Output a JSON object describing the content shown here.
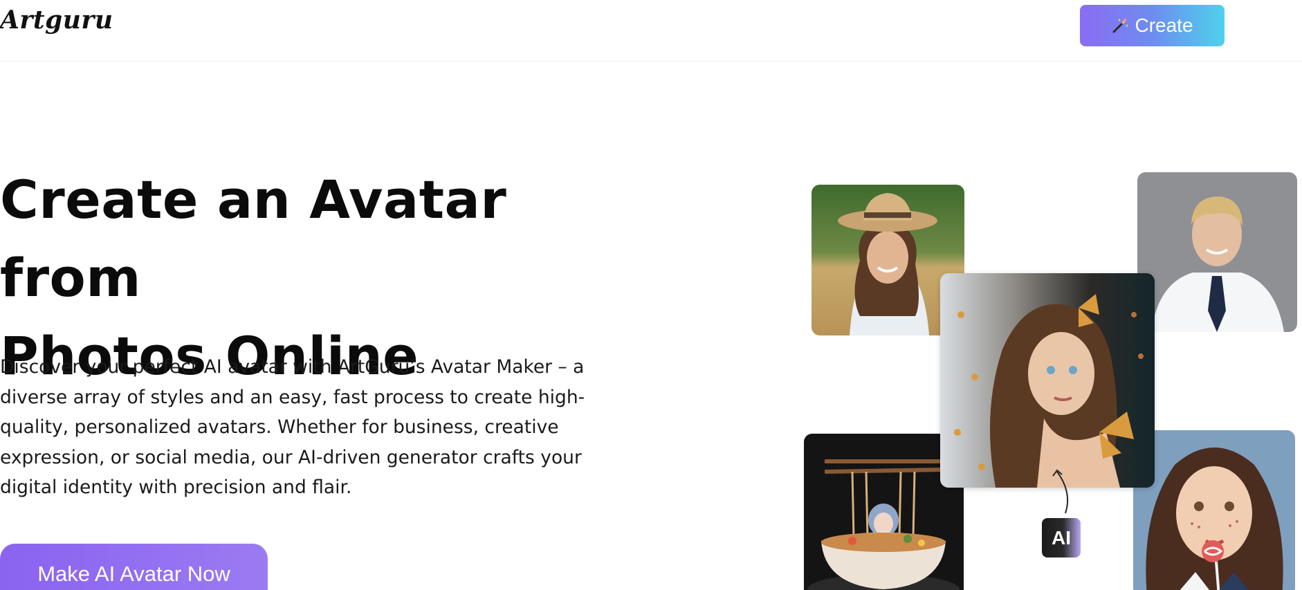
{
  "header": {
    "logo": "Artguru",
    "create_label": "Create"
  },
  "hero": {
    "title_line1": "Create an Avatar from",
    "title_line2": "Photos Online",
    "description": "Discover your perfect AI avatar with ArtGuru’s Avatar Maker – a diverse array of styles and an easy, fast process to create high-quality, personalized avatars. Whether for business, creative expression, or social media, our AI-driven generator crafts your digital identity with precision and flair.",
    "cta_label": "Make AI Avatar Now"
  },
  "collage": {
    "badge_label": "AI",
    "images": [
      {
        "icon": "woman-straw-hat-photo"
      },
      {
        "icon": "businessman-portrait-photo"
      },
      {
        "icon": "fantasy-butterfly-girl-avatar"
      },
      {
        "icon": "anime-girl-noodle-bowl-avatar"
      },
      {
        "icon": "freckled-girl-lollipop-avatar"
      }
    ]
  },
  "colors": {
    "brand_gradient_start": "#8b6cf2",
    "brand_gradient_end": "#4fd1ec",
    "cta_color": "#8a63ef"
  }
}
